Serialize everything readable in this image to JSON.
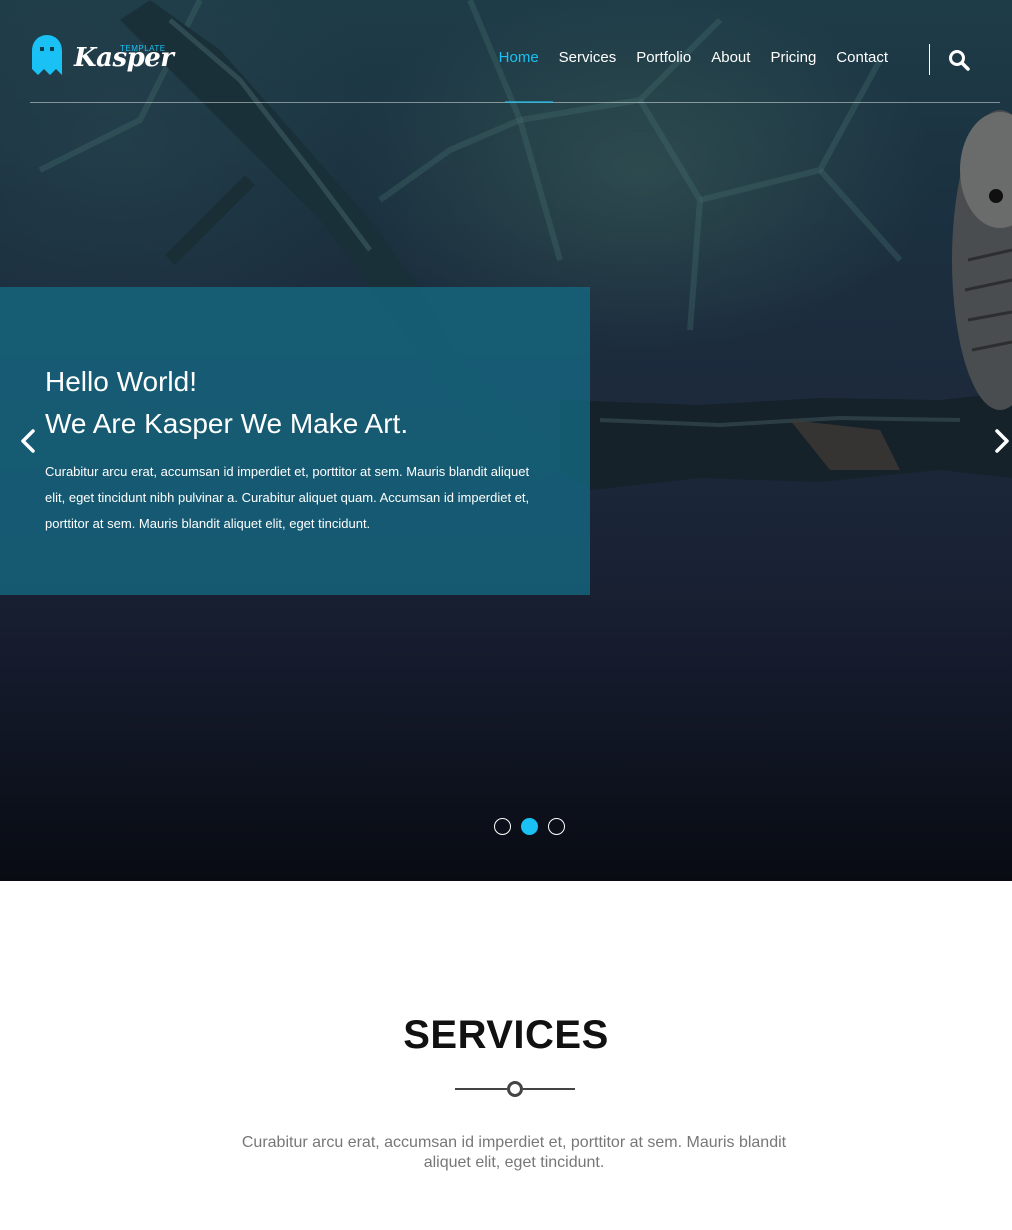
{
  "brand": {
    "name": "Kasper",
    "tag": "TEMPLATE"
  },
  "nav": {
    "items": [
      "Home",
      "Services",
      "Portfolio",
      "About",
      "Pricing",
      "Contact"
    ],
    "active": "Home"
  },
  "hero": {
    "title_line1": "Hello World!",
    "title_line2": "We Are Kasper We Make Art.",
    "text": "Curabitur arcu erat, accumsan id imperdiet et, porttitor at sem. Mauris blandit aliquet elit, eget tincidunt nibh pulvinar a. Curabitur aliquet quam. Accumsan id imperdiet et, porttitor at sem. Mauris blandit aliquet elit, eget tincidunt.",
    "slides_total": 3,
    "slide_active": 2
  },
  "services": {
    "title": "SERVICES",
    "description": "Curabitur arcu erat, accumsan id imperdiet et, porttitor at sem. Mauris blandit aliquet elit, eget tincidunt."
  },
  "icons": {
    "logo": "ghost-icon",
    "search": "search-icon",
    "prev": "chevron-left-icon",
    "next": "chevron-right-icon"
  },
  "colors": {
    "accent": "#19c1f5",
    "caption_bg": "#15667f",
    "text_dark": "#111111",
    "text_muted": "#777777"
  }
}
